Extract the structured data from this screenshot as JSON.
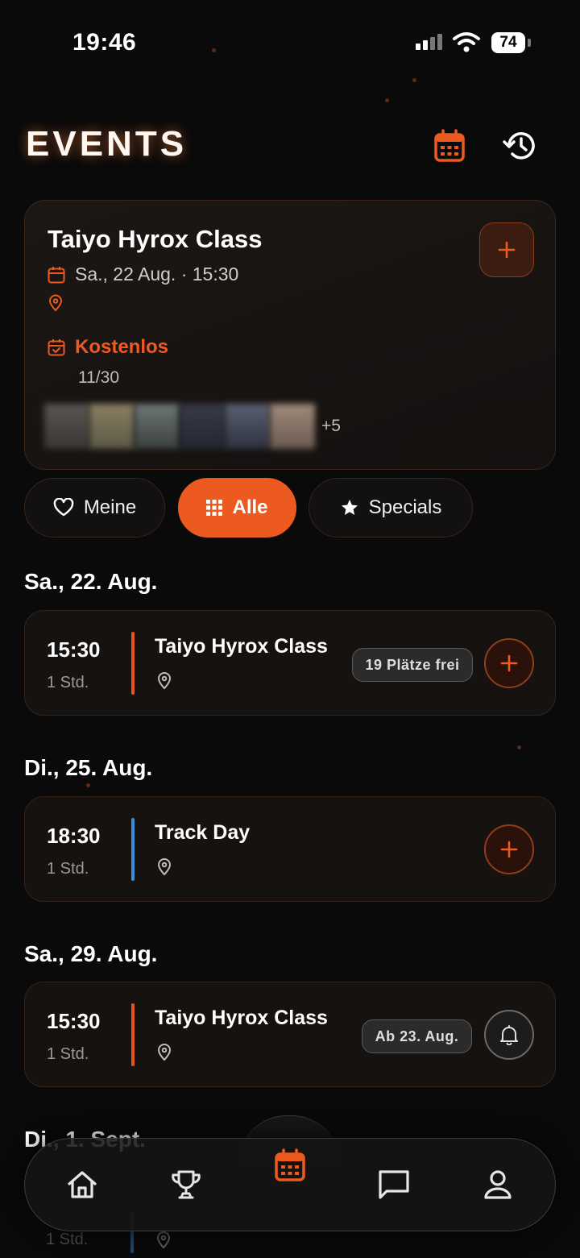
{
  "status_bar": {
    "time": "19:46",
    "battery": "74"
  },
  "header": {
    "title": "EVENTS"
  },
  "featured": {
    "title": "Taiyo Hyrox Class",
    "date": "Sa., 22 Aug. · 15:30",
    "price": "Kostenlos",
    "count": "11/30",
    "more_attendees": "+5"
  },
  "filters": {
    "meine": "Meine",
    "alle": "Alle",
    "specials": "Specials"
  },
  "days": [
    {
      "label": "Sa., 22. Aug.",
      "event": {
        "time": "15:30",
        "duration": "1 Std.",
        "title": "Taiyo Hyrox Class",
        "badge": "19 Plätze frei",
        "accent": "#e8541c"
      }
    },
    {
      "label": "Di., 25. Aug.",
      "event": {
        "time": "18:30",
        "duration": "1 Std.",
        "title": "Track Day",
        "accent": "#3a8ee0"
      }
    },
    {
      "label": "Sa., 29. Aug.",
      "event": {
        "time": "15:30",
        "duration": "1 Std.",
        "title": "Taiyo Hyrox Class",
        "badge": "Ab 23. Aug.",
        "accent": "#e8541c"
      }
    },
    {
      "label": "Di., 1. Sept.",
      "event": {
        "duration": "1 Std."
      }
    }
  ],
  "nav": {
    "items": [
      "home-icon",
      "trophy-icon",
      "calendar-icon",
      "chat-icon",
      "profile-icon"
    ]
  },
  "colors": {
    "accent": "#ec5a20",
    "blue": "#3a8ee0"
  }
}
